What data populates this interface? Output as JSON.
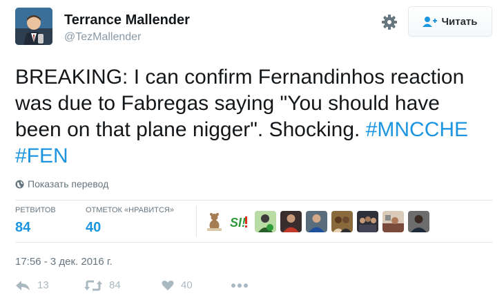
{
  "author": {
    "name": "Terrance Mallender",
    "handle": "@TezMallender"
  },
  "follow_button": {
    "label": "Читать"
  },
  "tweet": {
    "text": "BREAKING: I can confirm Fernandinhos reaction was due to Fabregas saying \"You should have been on that plane nigger\". Shocking.",
    "hashtags": [
      "#MNCCHE",
      "#FEN"
    ]
  },
  "translate_link": "Показать перевод",
  "stats": {
    "retweets_label": "РЕТВИТОВ",
    "retweets_count": "84",
    "likes_label": "ОТМЕТОК «НРАВИТСЯ»",
    "likes_count": "40"
  },
  "likers": [
    {
      "name": "liker-teddy"
    },
    {
      "name": "liker-si-logo",
      "text": "SI!"
    },
    {
      "name": "liker-green"
    },
    {
      "name": "liker-red-kit"
    },
    {
      "name": "liker-blue-kit"
    },
    {
      "name": "liker-people"
    },
    {
      "name": "liker-group"
    },
    {
      "name": "liker-room"
    },
    {
      "name": "liker-dark"
    }
  ],
  "timestamp": "17:56 - 3 дек. 2016 г.",
  "actions": {
    "reply_count": "13",
    "retweet_count": "84",
    "like_count": "40"
  },
  "colors": {
    "link": "#1b95e0",
    "muted": "#66757f",
    "action_icon": "#aab8c2"
  }
}
